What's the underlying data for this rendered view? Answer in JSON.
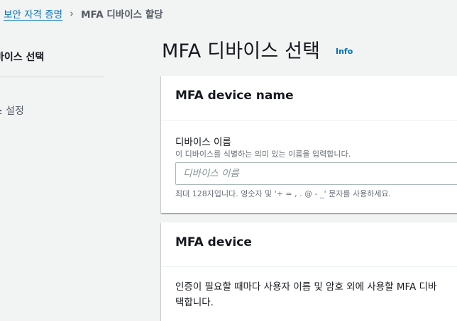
{
  "breadcrumb": {
    "parent": "보안 자격 증명",
    "separator": "›",
    "current": "MFA 디바이스 할당"
  },
  "nav": {
    "steps": [
      {
        "label": "바이스 선택",
        "active": true
      },
      {
        "label": "≥ 설정",
        "active": false
      }
    ]
  },
  "header": {
    "title": "MFA 디바이스 선택",
    "info": "Info"
  },
  "device_name_panel": {
    "title": "MFA device name",
    "label": "디바이스 이름",
    "description": "이 디바이스를 식별하는 의미 있는 이름을 입력합니다.",
    "placeholder": "디바이스 이름",
    "value": "",
    "constraint": "최대 128자입니다. 영숫자 및 '+ = , . @ - _' 문자를 사용하세요."
  },
  "device_panel": {
    "title": "MFA device",
    "line1": "인증이 필요할 때마다 사용자 이름 및 암호 외에 사용할 MFA 디바",
    "line2": "택합니다."
  },
  "colors": {
    "link": "#0073bb",
    "background": "#f2f3f3",
    "panel": "#ffffff",
    "text": "#16191f",
    "muted": "#687078"
  }
}
